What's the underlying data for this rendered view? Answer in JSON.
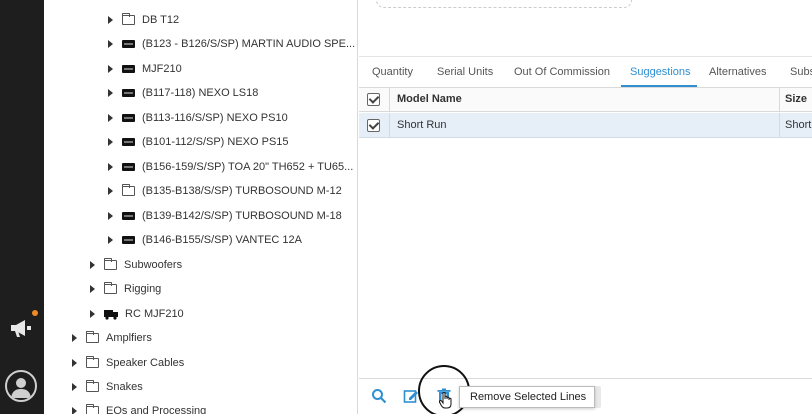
{
  "tree": {
    "items": [
      {
        "label": "DB T12",
        "type": "folder"
      },
      {
        "label": "(B123 - B126/S/SP) MARTIN AUDIO SPE...",
        "type": "device"
      },
      {
        "label": "MJF210",
        "type": "device"
      },
      {
        "label": "(B117-118) NEXO LS18",
        "type": "device"
      },
      {
        "label": "(B113-116/S/SP) NEXO PS10",
        "type": "device"
      },
      {
        "label": "(B101-112/S/SP) NEXO PS15",
        "type": "device"
      },
      {
        "label": "(B156-159/S/SP) TOA 20\" TH652 + TU65...",
        "type": "device"
      },
      {
        "label": "(B135-B138/S/SP) TURBOSOUND M-12",
        "type": "folder"
      },
      {
        "label": "(B139-B142/S/SP) TURBOSOUND M-18",
        "type": "device"
      },
      {
        "label": "(B146-B155/S/SP) VANTEC 12A",
        "type": "device"
      },
      {
        "label": "Subwoofers",
        "type": "folder"
      },
      {
        "label": "Rigging",
        "type": "folder"
      },
      {
        "label": "RC MJF210",
        "type": "truck"
      },
      {
        "label": "Amplfiers",
        "type": "folder"
      },
      {
        "label": "Speaker Cables",
        "type": "folder"
      },
      {
        "label": "Snakes",
        "type": "folder"
      },
      {
        "label": "EQs and Processing",
        "type": "folder"
      }
    ]
  },
  "tabs": [
    {
      "label": "Quantity"
    },
    {
      "label": "Serial Units"
    },
    {
      "label": "Out Of Commission"
    },
    {
      "label": "Suggestions",
      "active": true
    },
    {
      "label": "Alternatives"
    },
    {
      "label": "Subs"
    }
  ],
  "table": {
    "headers": {
      "model_name": "Model Name",
      "size": "Size"
    },
    "rows": [
      {
        "model_name": "Short Run",
        "size": "Short"
      }
    ]
  },
  "toolbar": {
    "tooltip": "Remove Selected Lines",
    "icons": [
      "search-icon",
      "edit-icon",
      "trash-icon",
      "dropdown-icon"
    ]
  },
  "rail": {
    "icons": [
      "megaphone-icon",
      "avatar"
    ],
    "notification_color": "#f08a24"
  },
  "colors": {
    "accent": "#2f8fd1",
    "rail": "#1e1e1e",
    "selected_row": "#e6eef8"
  }
}
